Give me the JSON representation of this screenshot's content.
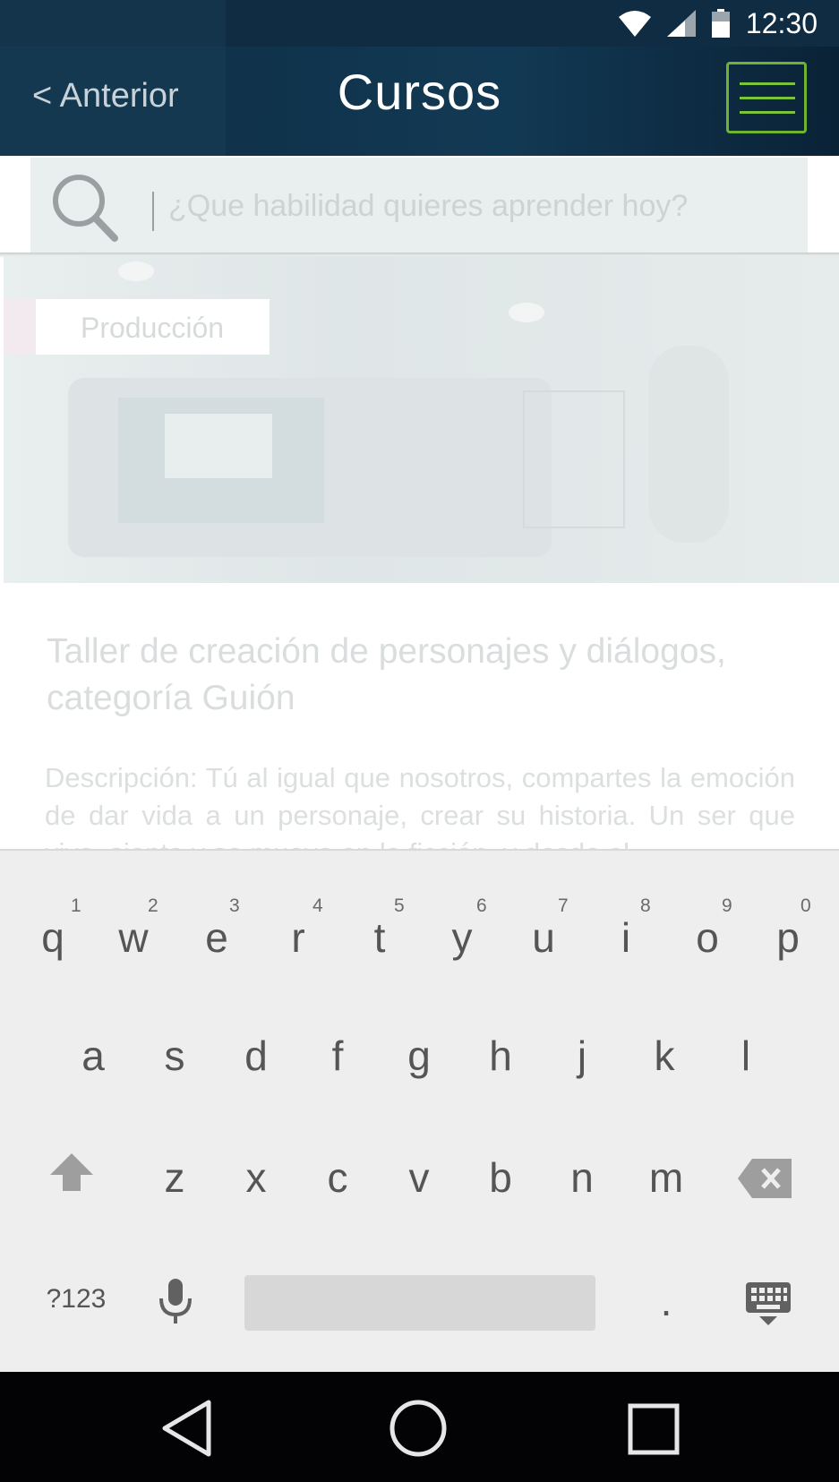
{
  "status_bar": {
    "time": "12:30"
  },
  "header": {
    "back_label": "< Anterior",
    "title": "Cursos",
    "menu_icon": "hamburger-menu-icon",
    "menu_border_color": "#6fb42e"
  },
  "search": {
    "placeholder": "¿Que habilidad quieres aprender hoy?",
    "value": ""
  },
  "course": {
    "category": "Producción",
    "title": "Taller de creación de personajes y diálogos, categoría Guión",
    "description": "Descripción: Tú al igual que nosotros, compartes la emoción de dar vida a un personaje, crear su historia. Un ser que viva, sienta y se mueva en la ficción, y desde el"
  },
  "keyboard": {
    "row1": [
      {
        "key": "q",
        "hint": "1"
      },
      {
        "key": "w",
        "hint": "2"
      },
      {
        "key": "e",
        "hint": "3"
      },
      {
        "key": "r",
        "hint": "4"
      },
      {
        "key": "t",
        "hint": "5"
      },
      {
        "key": "y",
        "hint": "6"
      },
      {
        "key": "u",
        "hint": "7"
      },
      {
        "key": "i",
        "hint": "8"
      },
      {
        "key": "o",
        "hint": "9"
      },
      {
        "key": "p",
        "hint": "0"
      }
    ],
    "row2": [
      "a",
      "s",
      "d",
      "f",
      "g",
      "h",
      "j",
      "k",
      "l"
    ],
    "row3": [
      "z",
      "x",
      "c",
      "v",
      "b",
      "n",
      "m"
    ],
    "symbols_label": "?123",
    "period_label": "."
  },
  "colors": {
    "header_dark": "#0f2c42",
    "accent_green": "#6fb42e",
    "keyboard_bg": "#eeeeee"
  }
}
